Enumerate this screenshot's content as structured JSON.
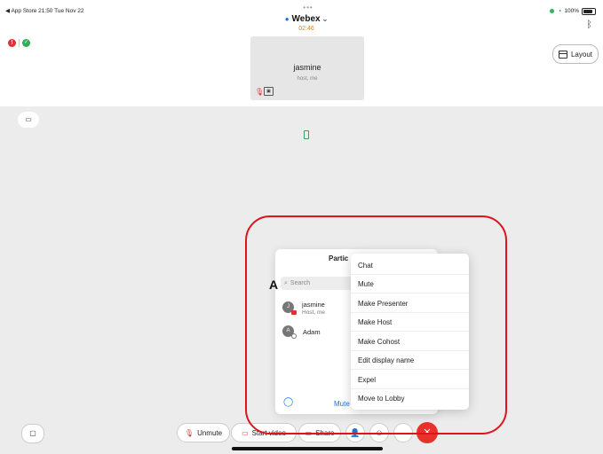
{
  "status_bar": {
    "left_text": "◀ App Store  21:50  Tue Nov 22",
    "battery": "100%"
  },
  "header": {
    "app_title": "Webex",
    "timer": "02:46",
    "layout_button": "Layout"
  },
  "self_tile": {
    "name": "jasmine",
    "role": "host, me"
  },
  "participants_panel": {
    "title": "Partic",
    "search_placeholder": "Search",
    "participants": [
      {
        "initial": "J",
        "name": "jasmine",
        "role": "Host, me"
      },
      {
        "initial": "A",
        "name": "Adam",
        "role": ""
      }
    ],
    "footer_action": "Mute"
  },
  "context_menu": {
    "items": [
      "Chat",
      "Mute",
      "Make Presenter",
      "Make Host",
      "Make Cohost",
      "Edit display name",
      "Expel",
      "Move to Lobby"
    ]
  },
  "toolbar": {
    "unmute": "Unmute",
    "start_video": "Start video",
    "share": "Share"
  },
  "icons": [
    "mic-off-icon",
    "video-off-icon",
    "share-icon",
    "participants-icon",
    "reactions-icon",
    "leave-icon",
    "bluetooth-icon",
    "wifi-icon",
    "battery-icon",
    "chat-icon"
  ],
  "colors": {
    "accent": "#1a73e8",
    "leave": "#e5332a",
    "annotation": "#e0141c",
    "timer": "#d9822b"
  }
}
